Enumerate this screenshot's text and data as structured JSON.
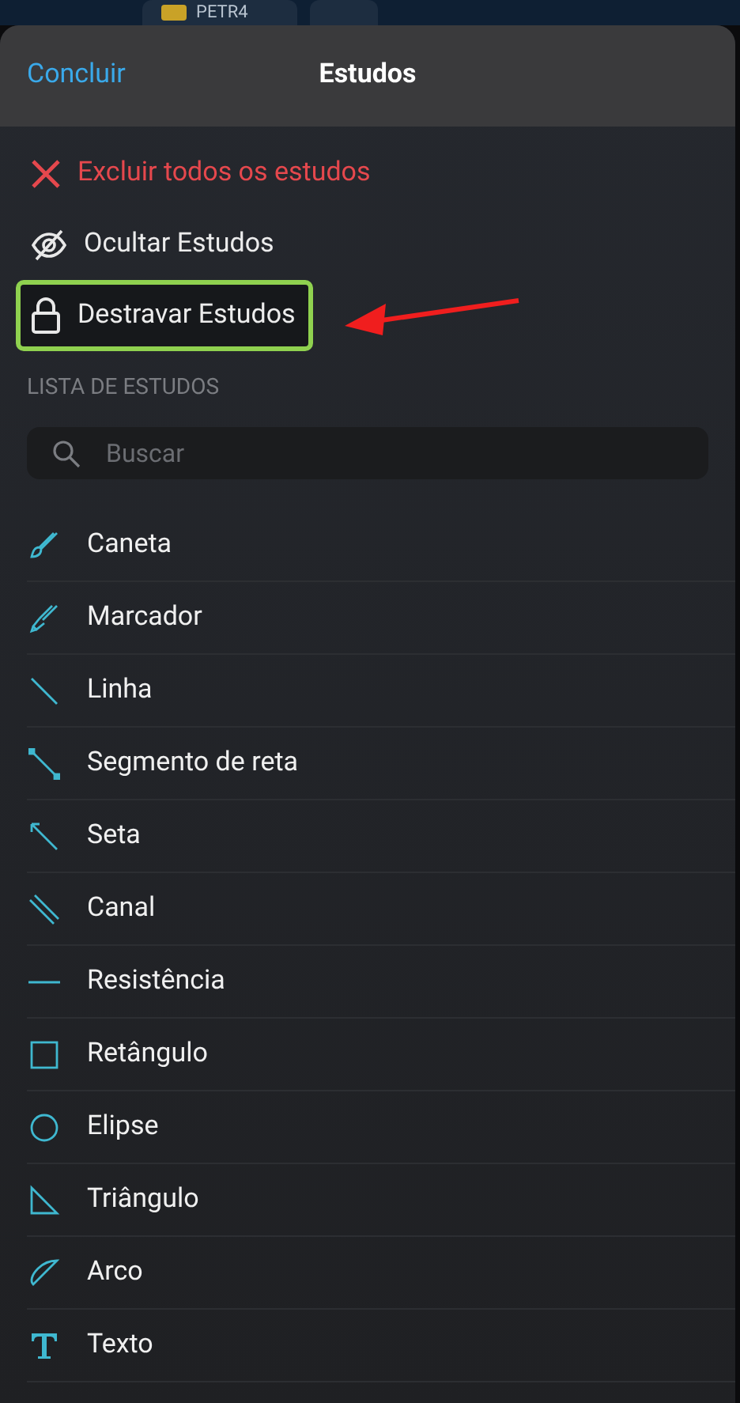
{
  "background_tab": {
    "label": "PETR4"
  },
  "header": {
    "done": "Concluir",
    "title": "Estudos"
  },
  "actions": [
    {
      "kind": "delete",
      "label": "Excluir todos os estudos",
      "highlighted": false
    },
    {
      "kind": "hide",
      "label": "Ocultar Estudos",
      "highlighted": false
    },
    {
      "kind": "unlock",
      "label": "Destravar Estudos",
      "highlighted": true
    }
  ],
  "section_title": "LISTA DE ESTUDOS",
  "search": {
    "placeholder": "Buscar"
  },
  "studies": [
    {
      "kind": "pen",
      "label": "Caneta"
    },
    {
      "kind": "marker",
      "label": "Marcador"
    },
    {
      "kind": "line",
      "label": "Linha"
    },
    {
      "kind": "segment",
      "label": "Segmento de reta"
    },
    {
      "kind": "arrow",
      "label": "Seta"
    },
    {
      "kind": "channel",
      "label": "Canal"
    },
    {
      "kind": "horizontal",
      "label": "Resistência"
    },
    {
      "kind": "rectangle",
      "label": "Retângulo"
    },
    {
      "kind": "ellipse",
      "label": "Elipse"
    },
    {
      "kind": "triangle",
      "label": "Triângulo"
    },
    {
      "kind": "arc",
      "label": "Arco"
    },
    {
      "kind": "text",
      "label": "Texto"
    }
  ]
}
